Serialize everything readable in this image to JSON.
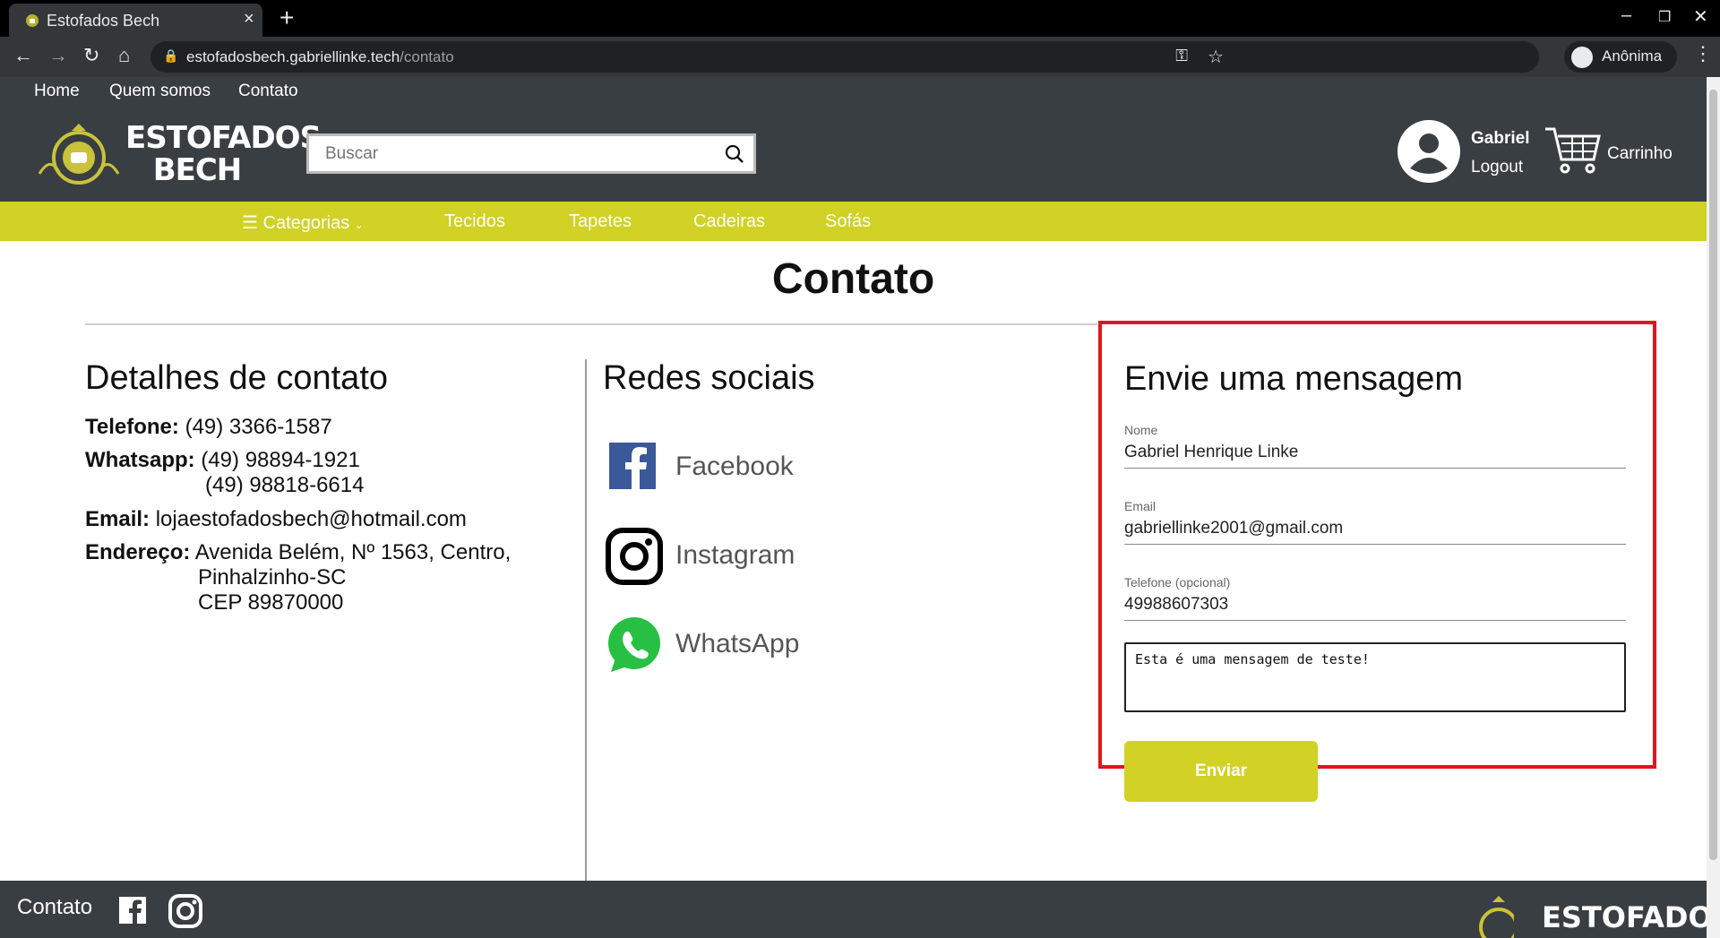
{
  "browser": {
    "tab_title": "Estofados Bech",
    "new_tab": "+",
    "close_tab": "×",
    "url_host": "estofadosbech.gabriellinke.tech",
    "url_path": "/contato",
    "profile_label": "Anônima"
  },
  "topnav": {
    "home": "Home",
    "about": "Quem somos",
    "contact": "Contato"
  },
  "logo": {
    "line1": "ESTOFADOS",
    "line2": "BECH"
  },
  "search": {
    "placeholder": "Buscar"
  },
  "user": {
    "name": "Gabriel",
    "logout": "Logout"
  },
  "cart": {
    "label": "Carrinho"
  },
  "categories": {
    "menu": "Categorias",
    "items": [
      "Tecidos",
      "Tapetes",
      "Cadeiras",
      "Sofás"
    ]
  },
  "page": {
    "title": "Contato"
  },
  "contact_details": {
    "heading": "Detalhes de contato",
    "phone_label": "Telefone:",
    "phone": "(49) 3366-1587",
    "whatsapp_label": "Whatsapp:",
    "whatsapp1": "(49) 98894-1921",
    "whatsapp2": "(49) 98818-6614",
    "email_label": "Email:",
    "email": "lojaestofadosbech@hotmail.com",
    "address_label": "Endereço:",
    "address1": "Avenida Belém, Nº 1563, Centro,",
    "address2": "Pinhalzinho-SC",
    "address3": "CEP 89870000"
  },
  "social": {
    "heading": "Redes sociais",
    "facebook": "Facebook",
    "instagram": "Instagram",
    "whatsapp": "WhatsApp"
  },
  "form": {
    "heading": "Envie uma mensagem",
    "name_label": "Nome",
    "name_value": "Gabriel Henrique Linke",
    "email_label": "Email",
    "email_value": "gabriellinke2001@gmail.com",
    "phone_label": "Telefone (opcional)",
    "phone_value": "49988607303",
    "message_value": "Esta é uma mensagem de teste!",
    "submit": "Enviar"
  },
  "footer": {
    "label": "Contato",
    "logo_text": "ESTOFADOS"
  },
  "colors": {
    "header": "#393e42",
    "accent": "#d1d126",
    "highlight": "#e0151d"
  }
}
